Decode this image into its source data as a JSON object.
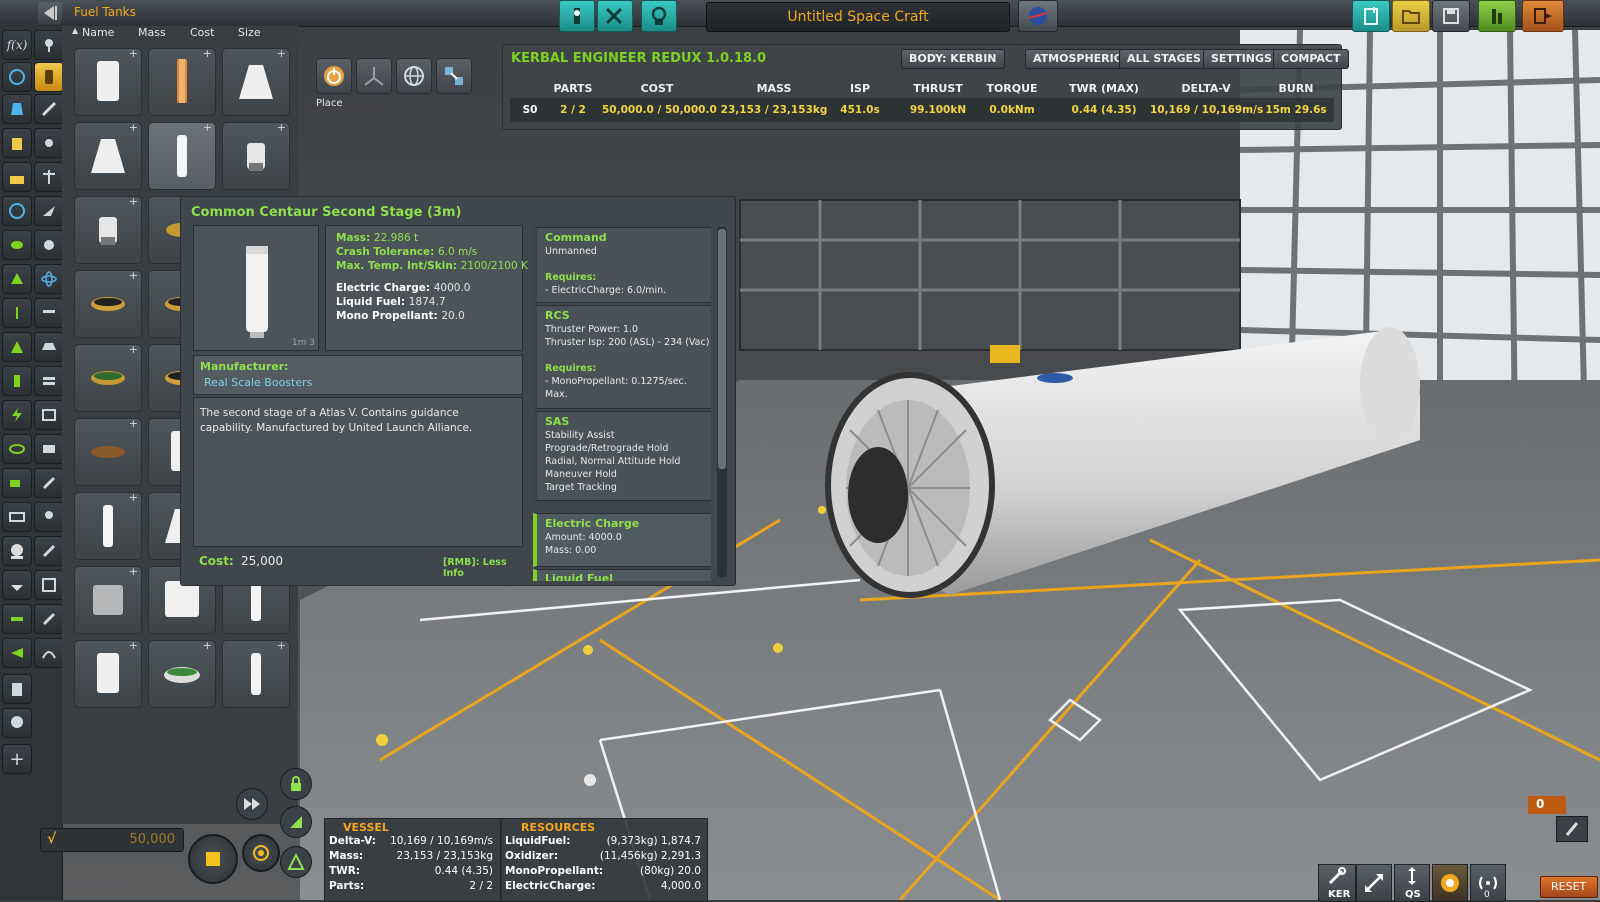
{
  "header": {
    "category_title": "Fuel Tanks",
    "craft_name": "Untitled Space Craft"
  },
  "sort": {
    "name": "Name",
    "mass": "Mass",
    "cost": "Cost",
    "size": "Size"
  },
  "tools": {
    "place_label": "Place"
  },
  "ker": {
    "title": "KERBAL ENGINEER REDUX 1.0.18.0",
    "buttons": [
      "BODY: KERBIN",
      "ATMOSPHERIC",
      "ALL STAGES",
      "SETTINGS",
      "COMPACT"
    ],
    "columns": [
      "PARTS",
      "COST",
      "MASS",
      "ISP",
      "THRUST",
      "TORQUE",
      "TWR (MAX)",
      "DELTA-V",
      "BURN"
    ],
    "row": {
      "stage": "S0",
      "parts": "2 / 2",
      "cost": "50,000.0 / 50,000.0",
      "mass": "23,153 / 23,153kg",
      "isp": "451.0s",
      "thrust": "99.100kN",
      "torque": "0.0kNm",
      "twr": "0.44 (4.35)",
      "deltav": "10,169 / 10,169m/s",
      "burn": "15m 29.6s"
    }
  },
  "part_info": {
    "title": "Common Centaur Second Stage (3m)",
    "size_label": "1m 3",
    "stats": [
      {
        "label": "Mass:",
        "value": "22.986 t",
        "style": "green"
      },
      {
        "label": "Crash Tolerance:",
        "value": "6.0 m/s",
        "style": "green"
      },
      {
        "label": "Max. Temp. Int/Skin:",
        "value": "2100/2100 K",
        "style": "green"
      },
      {
        "label": "Electric Charge:",
        "value": "4000.0",
        "style": "white"
      },
      {
        "label": "Liquid Fuel:",
        "value": "1874.7",
        "style": "white"
      },
      {
        "label": "Mono Propellant:",
        "value": "20.0",
        "style": "white"
      }
    ],
    "manufacturer_label": "Manufacturer:",
    "manufacturer": "Real Scale Boosters",
    "description": "The second stage of a Atlas V. Contains guidance capability. Manufactured by United Launch Alliance.",
    "cost_label": "Cost:",
    "cost": "25,000",
    "rmb_hint": "[RMB]: Less Info",
    "modules": {
      "command": {
        "title": "Command",
        "subtitle": "Unmanned",
        "requires": "Requires:",
        "line": "- ElectricCharge: 6.0/min."
      },
      "rcs": {
        "title": "RCS",
        "line1": "Thruster Power: 1.0",
        "line2": "Thruster Isp: 200 (ASL) - 234 (Vac)",
        "requires": "Requires:",
        "line3": "- MonoPropellant: 0.1275/sec.",
        "line4": "Max."
      },
      "sas": {
        "title": "SAS",
        "lines": [
          "Stability Assist",
          "Prograde/Retrograde Hold",
          "Radial, Normal Attitude Hold",
          "Maneuver Hold",
          "Target Tracking"
        ]
      },
      "electric": {
        "title": "Electric Charge",
        "line1": "Amount: 4000.0",
        "line2": "Mass: 0.00"
      },
      "liquid": {
        "title": "Liquid Fuel"
      }
    }
  },
  "vessel": {
    "header": "VESSEL",
    "rows": [
      {
        "k": "Delta-V:",
        "v": "10,169 / 10,169m/s"
      },
      {
        "k": "Mass:",
        "v": "23,153 / 23,153kg"
      },
      {
        "k": "TWR:",
        "v": "0.44 (4.35)"
      },
      {
        "k": "Parts:",
        "v": "2 / 2"
      }
    ]
  },
  "resources": {
    "header": "RESOURCES",
    "rows": [
      {
        "k": "LiquidFuel:",
        "v": "(9,373kg) 1,874.7"
      },
      {
        "k": "Oxidizer:",
        "v": "(11,456kg) 2,291.3"
      },
      {
        "k": "MonoPropellant:",
        "v": "(80kg) 20.0"
      },
      {
        "k": "ElectricCharge:",
        "v": "4,000.0"
      }
    ]
  },
  "funds": "50,000",
  "bottom_right": {
    "ker_label": "KER",
    "qs_label": "QS",
    "count": "0",
    "comm_count": "0",
    "reset": "RESET"
  }
}
